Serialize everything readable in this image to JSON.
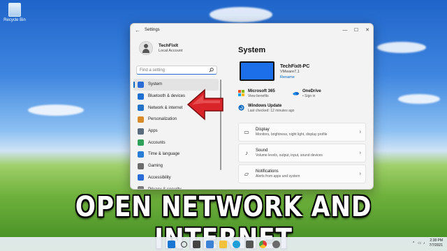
{
  "desktop": {
    "recycle_bin_label": "Recycle Bin"
  },
  "window": {
    "title": "Settings",
    "controls": {
      "minimize": "—",
      "maximize": "☐",
      "close": "✕"
    },
    "back_glyph": "←"
  },
  "profile": {
    "name": "TechFixIt",
    "account": "Local Account"
  },
  "search": {
    "placeholder": "Find a setting",
    "icon": "search-icon"
  },
  "nav": [
    {
      "label": "System",
      "color": "#2a6cd6",
      "active": true
    },
    {
      "label": "Bluetooth & devices",
      "color": "#1f6fd1",
      "active": false
    },
    {
      "label": "Network & internet",
      "color": "#2573c9",
      "active": false
    },
    {
      "label": "Personalization",
      "color": "#d98b2a",
      "active": false
    },
    {
      "label": "Apps",
      "color": "#5a6b7d",
      "active": false
    },
    {
      "label": "Accounts",
      "color": "#2fa05a",
      "active": false
    },
    {
      "label": "Time & language",
      "color": "#2a7dd6",
      "active": false
    },
    {
      "label": "Gaming",
      "color": "#6c6c6c",
      "active": false
    },
    {
      "label": "Accessibility",
      "color": "#2a6cd6",
      "active": false
    },
    {
      "label": "Privacy & security",
      "color": "#7a7a7a",
      "active": false
    }
  ],
  "main": {
    "title": "System",
    "pc": {
      "name": "TechFixIt-PC",
      "model": "VMware7,1",
      "rename": "Rename"
    },
    "services": [
      {
        "title": "Microsoft 365",
        "sub": "View benefits",
        "icon": "microsoft-365-icon"
      },
      {
        "title": "OneDrive",
        "sub": "• Sign in",
        "icon": "onedrive-icon"
      }
    ],
    "update": {
      "title": "Windows Update",
      "sub": "Last checked: 12 minutes ago"
    },
    "cards": [
      {
        "title": "Display",
        "sub": "Monitors, brightness, night light, display profile",
        "icon": "display-icon"
      },
      {
        "title": "Sound",
        "sub": "Volume levels, output, input, sound devices",
        "icon": "sound-icon"
      },
      {
        "title": "Notifications",
        "sub": "Alerts from apps and system",
        "icon": "notifications-icon"
      }
    ]
  },
  "banner": "OPEN NETWORK AND INTERNET",
  "taskbar": {
    "time": "2:38 PM",
    "date": "7/7/2021",
    "chevron": "^"
  },
  "colors": {
    "accent": "#0067c0",
    "arrow": "#d9252a"
  }
}
